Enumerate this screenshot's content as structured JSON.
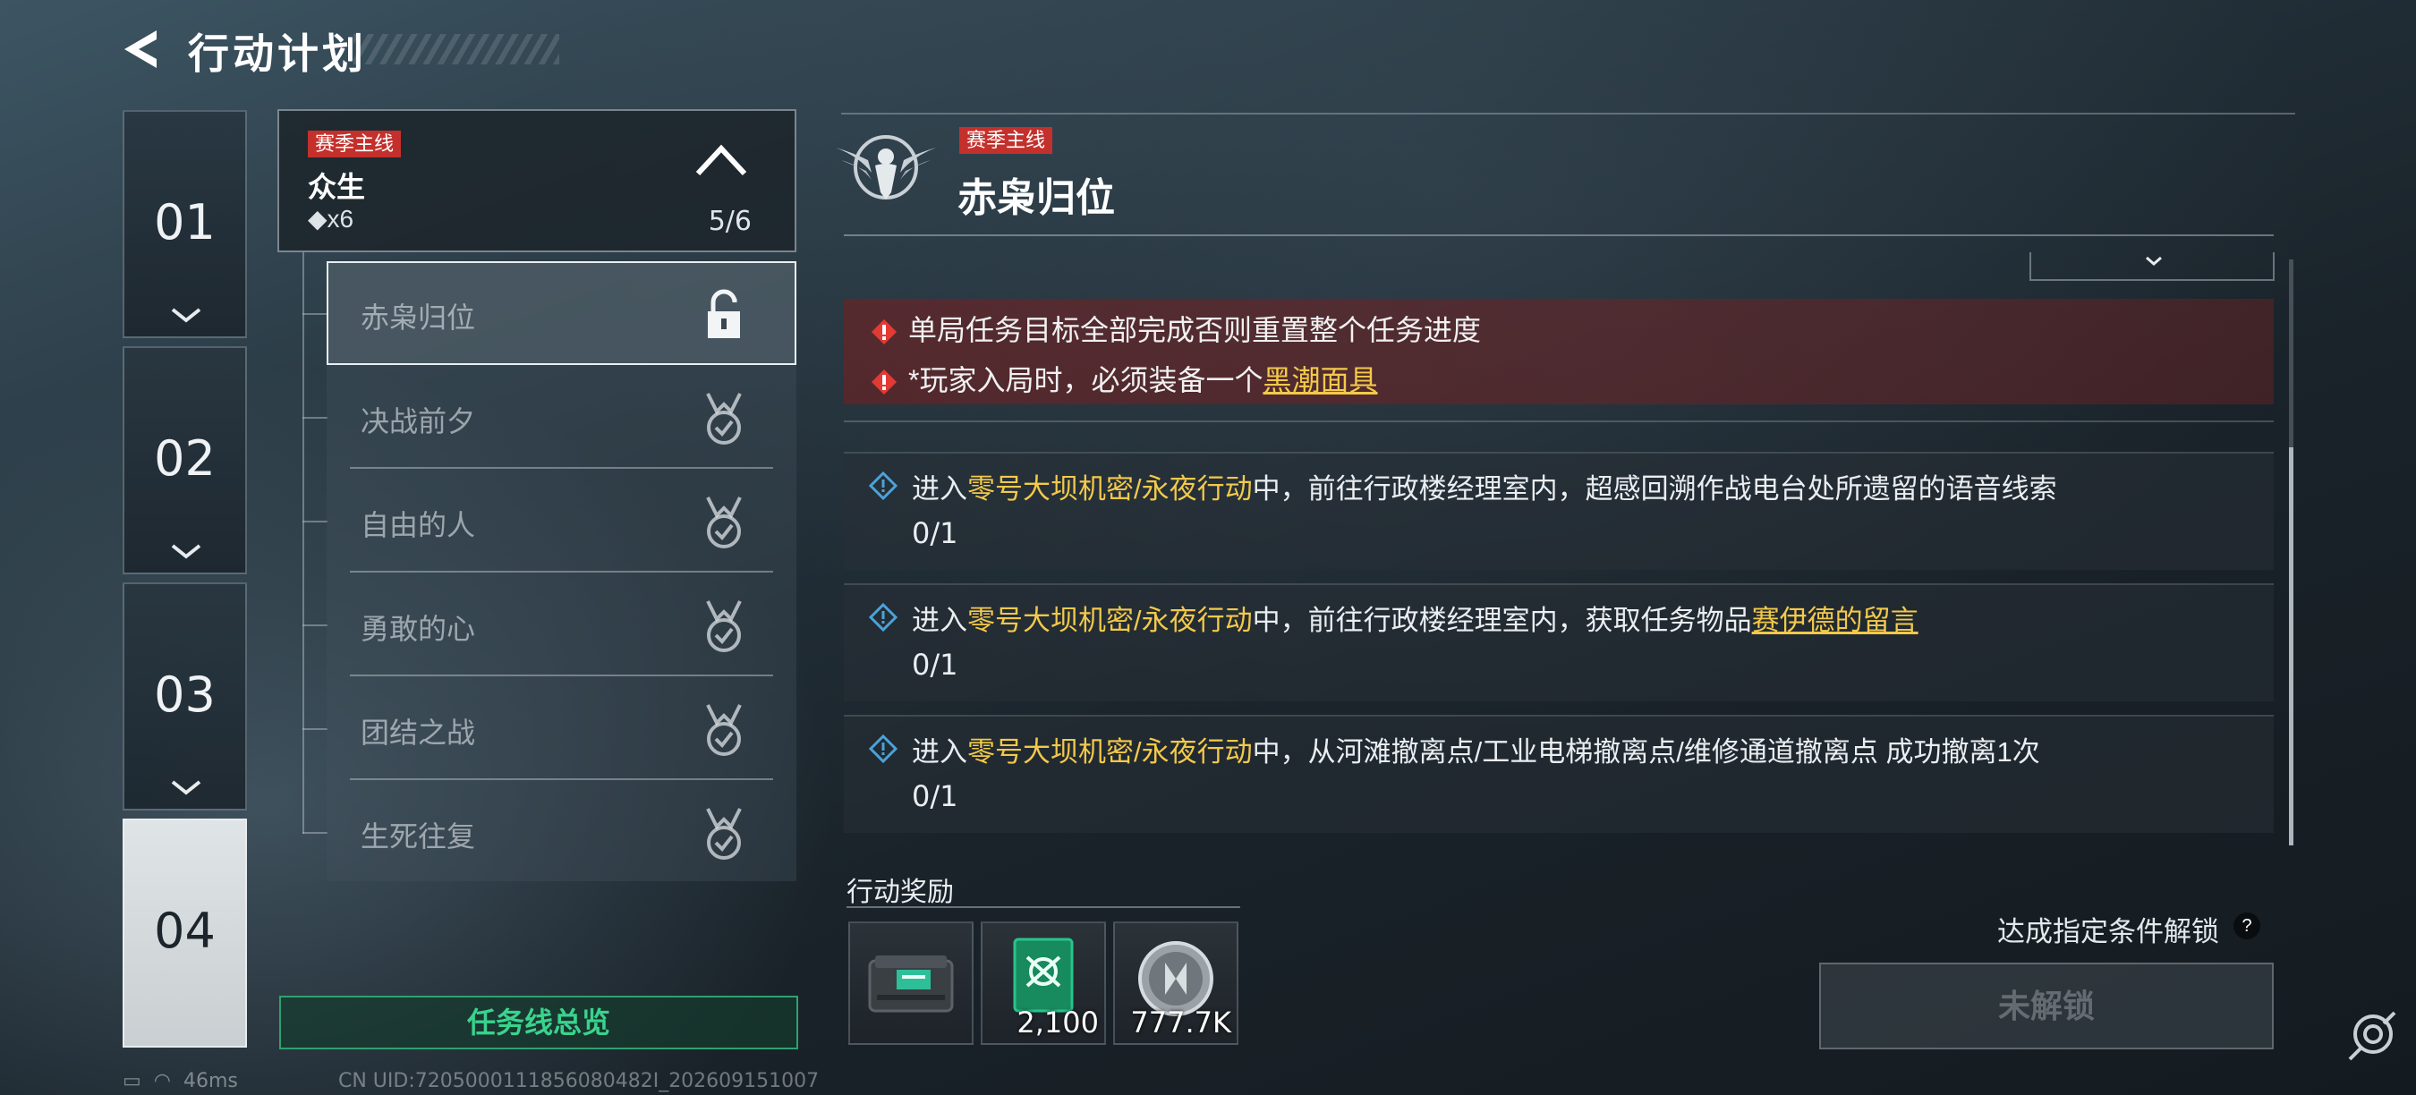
{
  "header": {
    "title": "行动计划"
  },
  "chapters": [
    {
      "num": "01",
      "active": false
    },
    {
      "num": "02",
      "active": false
    },
    {
      "num": "03",
      "active": false
    },
    {
      "num": "04",
      "active": true
    }
  ],
  "questline": {
    "tag": "赛季主线",
    "name": "众生",
    "reward": "◆x6",
    "progress": "5/6"
  },
  "missions": [
    {
      "label": "赤枭归位",
      "status": "locked"
    },
    {
      "label": "决战前夕",
      "status": "completed"
    },
    {
      "label": "自由的人",
      "status": "completed"
    },
    {
      "label": "勇敢的心",
      "status": "completed"
    },
    {
      "label": "团结之战",
      "status": "completed"
    },
    {
      "label": "生死往复",
      "status": "completed"
    }
  ],
  "overview_button": "任务线总览",
  "detail": {
    "tag": "赛季主线",
    "title": "赤枭归位",
    "warnings": [
      {
        "text": "单局任务目标全部完成否则重置整个任务进度",
        "link": ""
      },
      {
        "text": "*玩家入局时，必须装备一个",
        "link": "黑潮面具"
      }
    ],
    "objectives": [
      {
        "pre": "进入",
        "hl": "零号大坝机密/永夜行动",
        "post": "中，前往行政楼经理室内，超感回溯作战电台处所遗留的语音线索",
        "link": "",
        "count": "0/1"
      },
      {
        "pre": "进入",
        "hl": "零号大坝机密/永夜行动",
        "post": "中，前往行政楼经理室内，获取任务物品",
        "link": "赛伊德的留言",
        "count": "0/1"
      },
      {
        "pre": "进入",
        "hl": "零号大坝机密/永夜行动",
        "post": "中，从河滩撤离点/工业电梯撤离点/维修通道撤离点 成功撤离1次",
        "link": "",
        "count": "0/1"
      }
    ]
  },
  "rewards": {
    "title": "行动奖励",
    "items": [
      {
        "icon": "loot-box-icon",
        "qty": ""
      },
      {
        "icon": "drone-card-icon",
        "qty": "2,100"
      },
      {
        "icon": "silver-coin-icon",
        "qty": "777.7K"
      }
    ]
  },
  "unlock": {
    "hint": "达成指定条件解锁",
    "help": "?",
    "button": "未解锁"
  },
  "status": {
    "ping": "46ms",
    "uid": "CN UID:7205000111856080482I_202609151007"
  },
  "colors": {
    "accent_green": "#39d38d",
    "tag_red": "#c4302b",
    "highlight_yellow": "#f3c94a",
    "warning_bg": "#7a2424"
  }
}
